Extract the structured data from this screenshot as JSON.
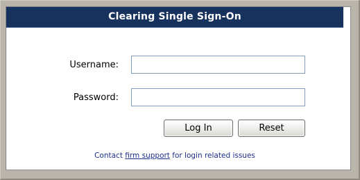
{
  "title": "Clearing Single Sign-On",
  "form": {
    "username_label": "Username:",
    "username_value": "",
    "password_label": "Password:",
    "password_value": ""
  },
  "buttons": {
    "login_label": "Log In",
    "reset_label": "Reset"
  },
  "footer": {
    "prefix": "Contact ",
    "link_text": "firm support",
    "suffix": " for login related issues"
  },
  "colors": {
    "title_bar_bg": "#17325d",
    "title_text": "#ffffff",
    "outer_frame": "#b9b5ab",
    "link": "#1b2f8e",
    "input_border": "#7f9db9"
  }
}
